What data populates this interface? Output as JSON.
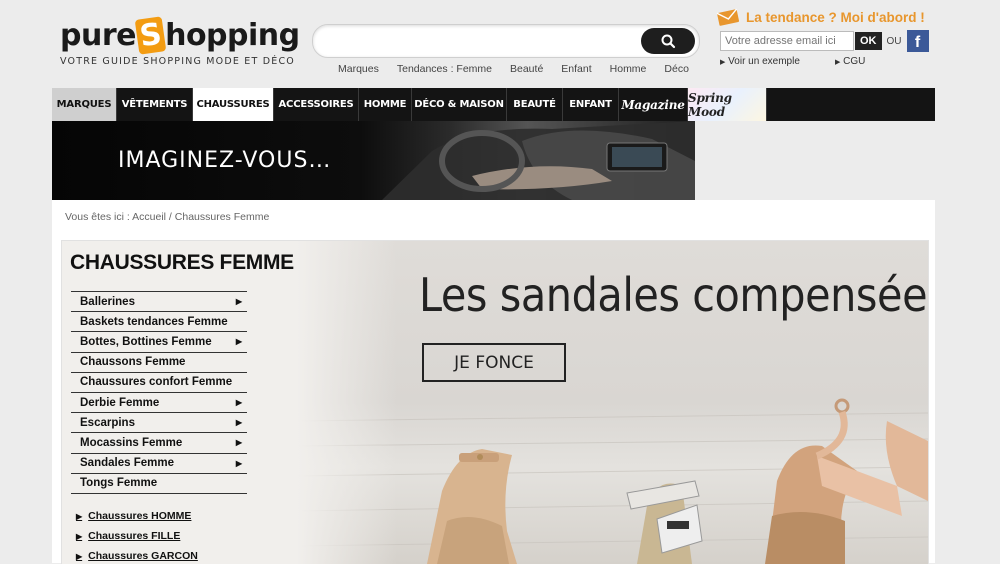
{
  "brand": {
    "name_before_s": "pure",
    "name_s": "S",
    "name_after_s": "hopping",
    "tagline": "VOTRE GUIDE SHOPPING MODE ET DÉCO"
  },
  "search": {
    "placeholder": ""
  },
  "quick_links": [
    "Marques",
    "Tendances : Femme",
    "Beauté",
    "Enfant",
    "Homme",
    "Déco"
  ],
  "promo": {
    "title": "La tendance ? Moi d'abord !",
    "email_placeholder": "Votre adresse email ici",
    "ok_label": "OK",
    "or_label": "OU",
    "facebook_glyph": "f",
    "example_link": "Voir un exemple",
    "cgu_link": "CGU"
  },
  "nav": {
    "items": [
      "MARQUES",
      "VÊTEMENTS",
      "CHAUSSURES",
      "ACCESSOIRES",
      "HOMME",
      "DÉCO & MAISON",
      "BEAUTÉ",
      "ENFANT",
      "Magazine",
      "Spring Mood"
    ],
    "active": "CHAUSSURES"
  },
  "banner": {
    "text": "IMAGINEZ-VOUS…"
  },
  "breadcrumb": {
    "prefix": "Vous êtes ici :",
    "home": "Accueil",
    "separator": "/",
    "current": "Chaussures Femme"
  },
  "category": {
    "title": "CHAUSSURES FEMME",
    "items": [
      {
        "label": "Ballerines",
        "has_sub": true
      },
      {
        "label": "Baskets tendances Femme",
        "has_sub": false
      },
      {
        "label": "Bottes, Bottines Femme",
        "has_sub": true
      },
      {
        "label": "Chaussons Femme",
        "has_sub": false
      },
      {
        "label": "Chaussures confort Femme",
        "has_sub": false
      },
      {
        "label": "Derbie Femme",
        "has_sub": true
      },
      {
        "label": "Escarpins",
        "has_sub": true
      },
      {
        "label": "Mocassins Femme",
        "has_sub": true
      },
      {
        "label": "Sandales Femme",
        "has_sub": true
      },
      {
        "label": "Tongs Femme",
        "has_sub": false
      }
    ],
    "gender_links": [
      "Chaussures HOMME",
      "Chaussures FILLE",
      "Chaussures GARCON"
    ]
  },
  "hero": {
    "title": "Les sandales compensées",
    "button_label": "JE FONCE"
  },
  "colors": {
    "accent_orange": "#e8962d",
    "nav_bg": "#141414",
    "facebook": "#3b5998"
  }
}
